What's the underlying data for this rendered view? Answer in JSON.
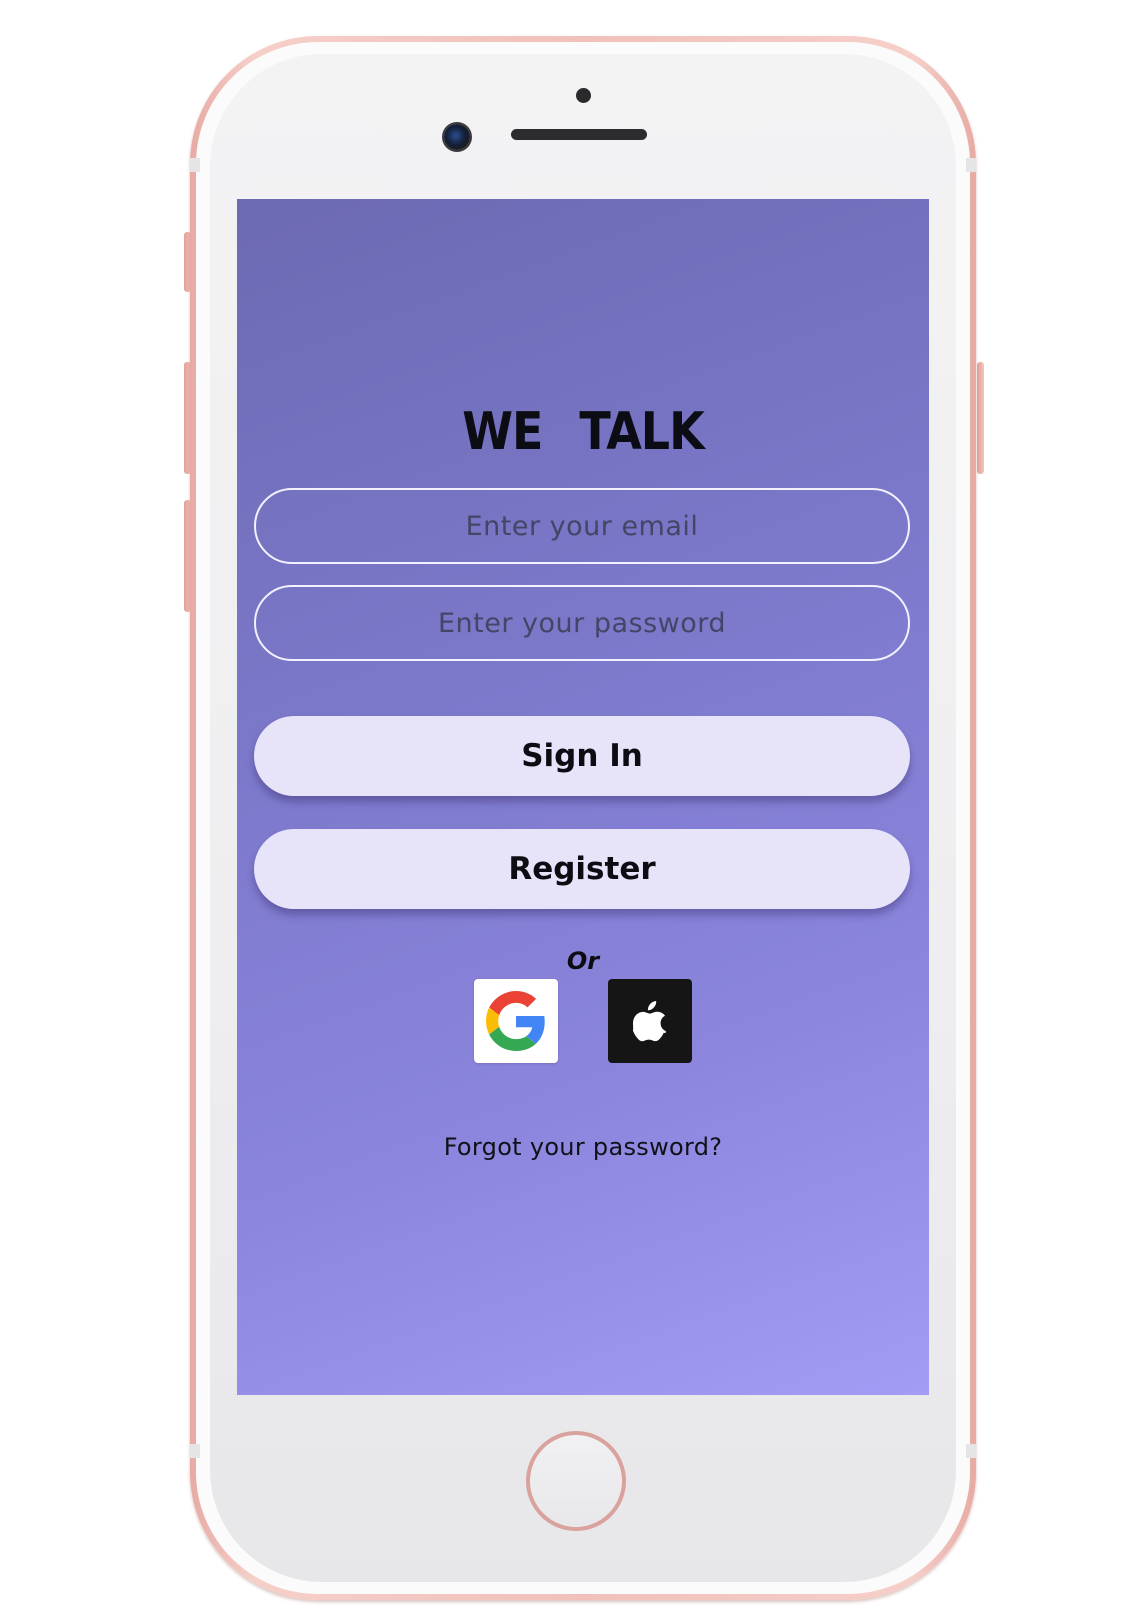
{
  "app": {
    "title": "WE TALK"
  },
  "login_form": {
    "email_placeholder": "Enter your email",
    "password_placeholder": "Enter your password",
    "sign_in_label": "Sign In",
    "register_label": "Register",
    "or_label": "Or",
    "forgot_password_label": "Forgot your password?"
  },
  "social_login": {
    "google_icon": "google-g-logo",
    "apple_icon": "apple-logo"
  },
  "colors": {
    "screen_gradient_start": "#6c6ab2",
    "screen_gradient_end": "#a39cf5",
    "button_background": "#e7e4fa",
    "phone_frame": "#f1c0ba",
    "apple_button": "#151515"
  }
}
